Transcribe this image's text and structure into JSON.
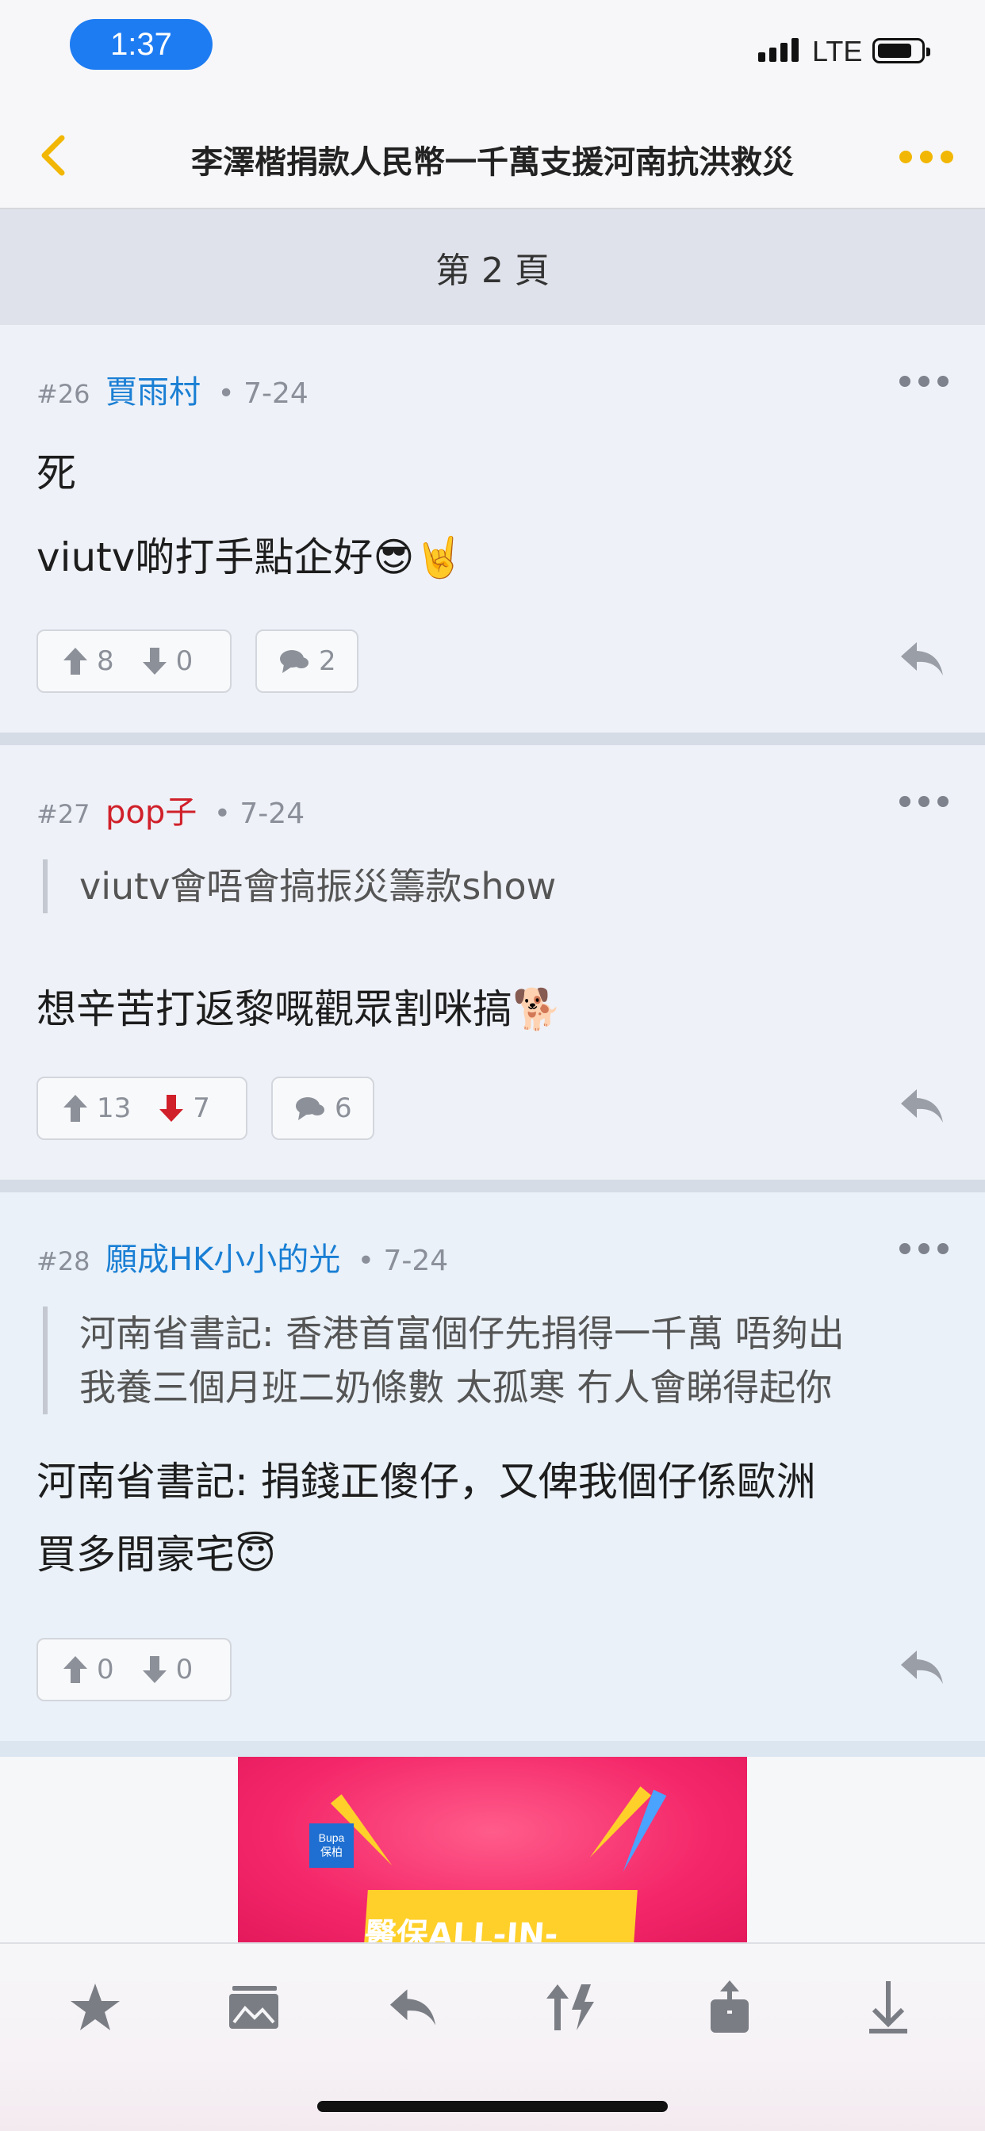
{
  "status_bar": {
    "time": "1:37",
    "network": "LTE"
  },
  "nav": {
    "title": "李澤楷捐款人民幣一千萬支援河南抗洪救災"
  },
  "page_header": "第 2 頁",
  "posts": [
    {
      "number": "#26",
      "author": "賈雨村",
      "author_color": "#1a7fd4",
      "date": "7-24",
      "lines": [
        "死",
        "viutv啲打手點企好😎🤘"
      ],
      "upvotes": "8",
      "downvotes": "0",
      "comments": "2"
    },
    {
      "number": "#27",
      "author": "pop子",
      "author_color": "#d0202a",
      "date": "7-24",
      "quote": [
        "viutv會唔會搞振災籌款show"
      ],
      "lines": [
        "想辛苦打返黎嘅觀眾割咪搞🐕"
      ],
      "upvotes": "13",
      "downvotes": "7",
      "comments": "6"
    },
    {
      "number": "#28",
      "author": "願成HK小小的光",
      "author_color": "#1a7fd4",
      "date": "7-24",
      "quote": [
        "河南省書記: 香港首富個仔先捐得一千萬 唔夠出",
        "我養三個月班二奶條數 太孤寒 冇人會睇得起你"
      ],
      "lines": [
        "河南省書記: 捐錢正傻仔，又俾我個仔係歐洲",
        "買多間豪宅😇"
      ],
      "upvotes": "0",
      "downvotes": "0"
    }
  ],
  "ad": {
    "logo_line1": "Bupa",
    "logo_line2": "保柏",
    "headline": "醫保ALL-IN-ONE!"
  },
  "toolbar": [
    "star-icon",
    "gallery-icon",
    "reply-icon",
    "sort-icon",
    "share-icon",
    "download-icon"
  ],
  "colors": {
    "accent": "#f2b705",
    "link_blue": "#1a7fd4",
    "downvote_red": "#d0202a"
  }
}
